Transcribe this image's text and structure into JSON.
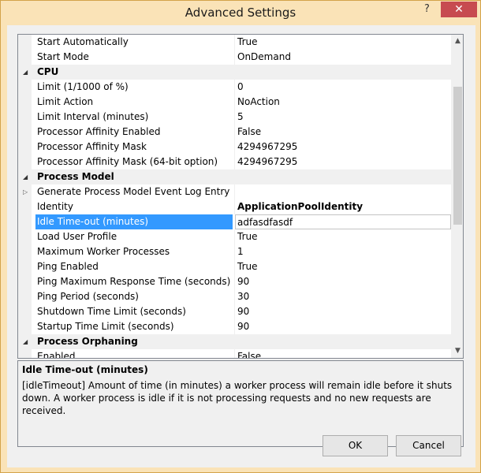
{
  "window": {
    "title": "Advanced Settings",
    "help_label": "?",
    "close_label": "✕"
  },
  "grid": {
    "rows": [
      {
        "name": "Start Automatically",
        "value": "True"
      },
      {
        "name": "Start Mode",
        "value": "OnDemand"
      },
      {
        "name": "CPU",
        "category": true
      },
      {
        "name": "Limit (1/1000 of %)",
        "value": "0"
      },
      {
        "name": "Limit Action",
        "value": "NoAction"
      },
      {
        "name": "Limit Interval (minutes)",
        "value": "5"
      },
      {
        "name": "Processor Affinity Enabled",
        "value": "False"
      },
      {
        "name": "Processor Affinity Mask",
        "value": "4294967295"
      },
      {
        "name": "Processor Affinity Mask (64-bit option)",
        "value": "4294967295"
      },
      {
        "name": "Process Model",
        "category": true
      },
      {
        "name": "Generate Process Model Event Log Entry",
        "value": ""
      },
      {
        "name": "Identity",
        "value": "ApplicationPoolIdentity"
      },
      {
        "name": "Idle Time-out (minutes)",
        "value": "adfasdfasdf"
      },
      {
        "name": "Load User Profile",
        "value": "True"
      },
      {
        "name": "Maximum Worker Processes",
        "value": "1"
      },
      {
        "name": "Ping Enabled",
        "value": "True"
      },
      {
        "name": "Ping Maximum Response Time (seconds)",
        "value": "90"
      },
      {
        "name": "Ping Period (seconds)",
        "value": "30"
      },
      {
        "name": "Shutdown Time Limit (seconds)",
        "value": "90"
      },
      {
        "name": "Startup Time Limit (seconds)",
        "value": "90"
      },
      {
        "name": "Process Orphaning",
        "category": true
      },
      {
        "name": "Enabled",
        "value": "False"
      }
    ]
  },
  "description": {
    "title": "Idle Time-out (minutes)",
    "text": "[idleTimeout] Amount of time (in minutes) a worker process will remain idle before it shuts down. A worker process is idle if it is not processing requests and no new requests are received."
  },
  "buttons": {
    "ok": "OK",
    "cancel": "Cancel"
  }
}
